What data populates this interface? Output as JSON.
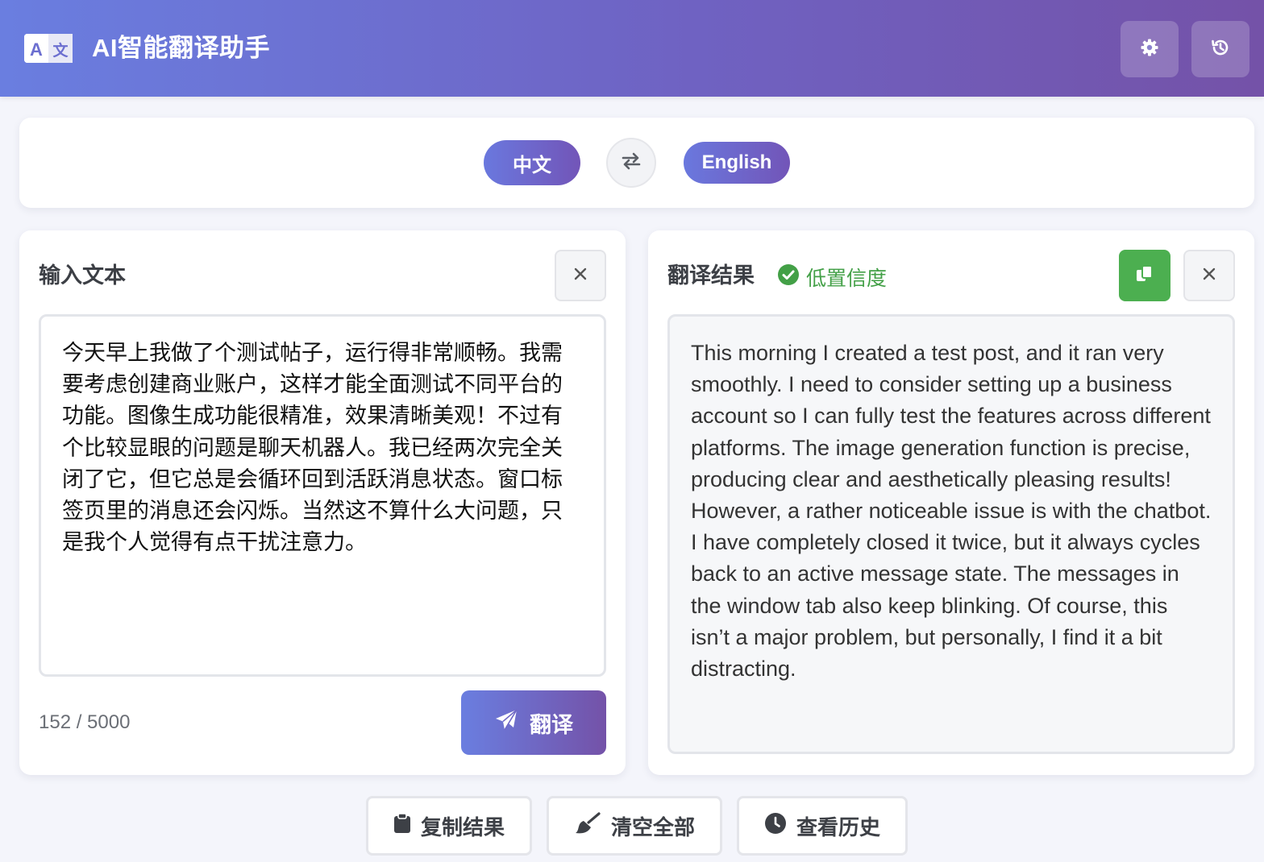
{
  "header": {
    "logo_text": "A文",
    "title": "AI智能翻译助手",
    "settings_icon": "gear-icon",
    "history_icon": "history-icon"
  },
  "languages": {
    "source": "中文",
    "target": "English",
    "swap_icon": "swap-arrows-icon"
  },
  "input_panel": {
    "title": "输入文本",
    "text": "今天早上我做了个测试帖子，运行得非常顺畅。我需要考虑创建商业账户，这样才能全面测试不同平台的功能。图像生成功能很精准，效果清晰美观！不过有个比较显眼的问题是聊天机器人。我已经两次完全关闭了它，但它总是会循环回到活跃消息状态。窗口标签页里的消息还会闪烁。当然这不算什么大问题，只是我个人觉得有点干扰注意力。",
    "counter": "152 / 5000",
    "translate_label": "翻译"
  },
  "output_panel": {
    "title": "翻译结果",
    "confidence": "低置信度",
    "text": "This morning I created a test post, and it ran very smoothly. I need to consider setting up a business account so I can fully test the features across different platforms. The image generation function is precise, producing clear and aesthetically pleasing results! However, a rather noticeable issue is with the chatbot. I have completely closed it twice, but it always cycles back to an active message state. The messages in the window tab also keep blinking. Of course, this isn’t a major problem, but personally, I find it a bit distracting."
  },
  "actions": {
    "copy_label": "复制结果",
    "clear_label": "清空全部",
    "history_label": "查看历史"
  },
  "colors": {
    "accent_start": "#6a7ee0",
    "accent_end": "#7452a8",
    "success": "#4caf50"
  }
}
